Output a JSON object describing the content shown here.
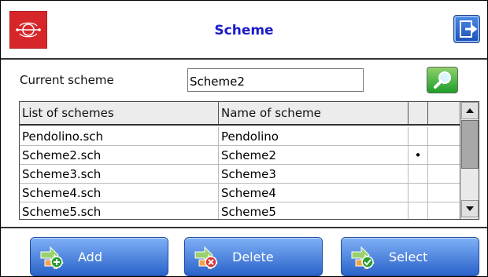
{
  "window": {
    "title": "Scheme"
  },
  "form": {
    "current_scheme_label": "Current scheme",
    "current_scheme_value": "Scheme2"
  },
  "table": {
    "headers": [
      "List of schemes",
      "Name of scheme",
      "",
      ""
    ],
    "rows": [
      {
        "file": "Pendolino.sch",
        "name": "Pendolino",
        "marker": ""
      },
      {
        "file": "Scheme2.sch",
        "name": "Scheme2",
        "marker": "•"
      },
      {
        "file": "Scheme3.sch",
        "name": "Scheme3",
        "marker": ""
      },
      {
        "file": "Scheme4.sch",
        "name": "Scheme4",
        "marker": ""
      },
      {
        "file": "Scheme5.sch",
        "name": "Scheme5",
        "marker": ""
      }
    ]
  },
  "footer": {
    "add_label": "Add",
    "delete_label": "Delete",
    "select_label": "Select"
  },
  "icons": {
    "logo": "red-circle-logo-icon",
    "exit": "exit-icon",
    "search": "search-icon",
    "scroll_up": "scroll-up-arrow-icon",
    "scroll_down": "scroll-down-arrow-icon",
    "add": "add-icon",
    "delete": "delete-icon",
    "select": "select-icon"
  },
  "colors": {
    "title": "#1b1bc9",
    "logo_bg": "#d7262a",
    "button_blue": "#2a63c9",
    "search_green": "#1e9f28"
  }
}
